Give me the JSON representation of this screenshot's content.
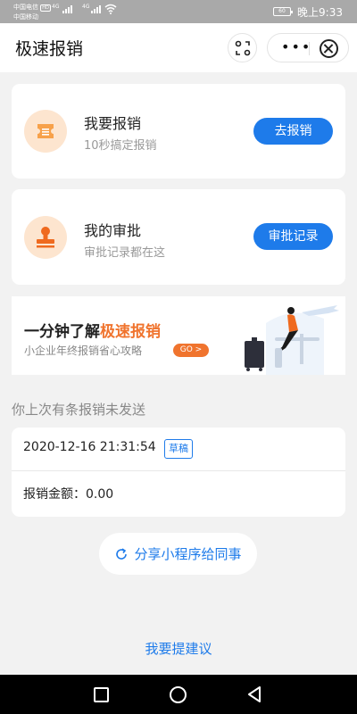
{
  "status_bar": {
    "carrier_primary": "中国电信",
    "carrier_primary_tag": "HD",
    "carrier_secondary": "中国移动",
    "net_type_1": "4G",
    "net_type_2": "4G",
    "battery_text": "60",
    "time": "晚上9:33"
  },
  "app_bar": {
    "title": "极速报销",
    "more_label": "•••"
  },
  "cards": {
    "reimburse": {
      "title": "我要报销",
      "subtitle": "10秒搞定报销",
      "button": "去报销",
      "icon": "ticket-icon"
    },
    "approval": {
      "title": "我的审批",
      "subtitle": "审批记录都在这",
      "button": "审批记录",
      "icon": "stamp-icon"
    }
  },
  "banner": {
    "title_prefix": "一分钟了解",
    "title_accent": "极速报销",
    "subtitle": "小企业年终报销省心攻略",
    "go_label": "GO >"
  },
  "pending": {
    "section_label": "你上次有条报销未发送",
    "timestamp": "2020-12-16 21:31:54",
    "status_tag": "草稿",
    "amount_label": "报销金额：",
    "amount_value": "0.00"
  },
  "share": {
    "label": "分享小程序给同事",
    "icon": "refresh-icon"
  },
  "footer": {
    "suggestion_link": "我要提建议"
  },
  "colors": {
    "accent_blue": "#1e7bea",
    "accent_orange": "#f0742e",
    "icon_bg": "#fde5cf"
  }
}
